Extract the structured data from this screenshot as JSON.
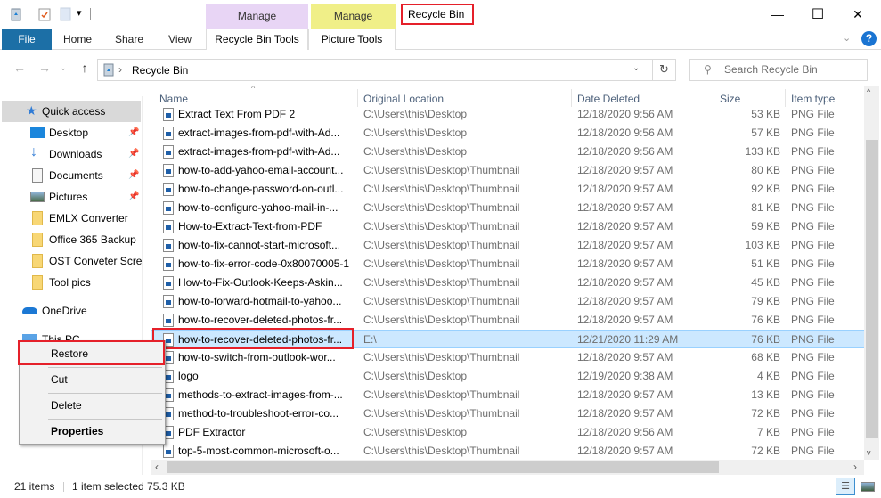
{
  "window": {
    "title": "Recycle Bin",
    "controls": {
      "minimize": "—",
      "maximize": "☐",
      "close": "✕"
    }
  },
  "ribbon": {
    "contextual_groups": [
      {
        "label": "Manage",
        "sub": "Recycle Bin Tools",
        "color": "#e8d5f5"
      },
      {
        "label": "Manage",
        "sub": "Picture Tools",
        "color": "#f0ef88"
      }
    ],
    "tabs": [
      "File",
      "Home",
      "Share",
      "View"
    ]
  },
  "address": {
    "path": "Recycle Bin",
    "separator": "›",
    "search_placeholder": "Search Recycle Bin"
  },
  "sidebar": {
    "items": [
      {
        "label": "Quick access",
        "icon": "star-icon",
        "pinned": false,
        "selected": true
      },
      {
        "label": "Desktop",
        "icon": "desktop-icon",
        "pinned": true
      },
      {
        "label": "Downloads",
        "icon": "download-icon",
        "pinned": true
      },
      {
        "label": "Documents",
        "icon": "documents-icon",
        "pinned": true
      },
      {
        "label": "Pictures",
        "icon": "pictures-icon",
        "pinned": true
      },
      {
        "label": "EMLX Converter",
        "icon": "folder-icon",
        "pinned": false
      },
      {
        "label": "Office 365 Backup",
        "icon": "folder-icon",
        "pinned": false
      },
      {
        "label": "OST Conveter  Screens",
        "icon": "folder-icon",
        "pinned": false
      },
      {
        "label": "Tool pics",
        "icon": "folder-icon",
        "pinned": false
      },
      {
        "label": "OneDrive",
        "icon": "cloud-icon",
        "pinned": false
      },
      {
        "label": "This PC",
        "icon": "pc-icon",
        "pinned": false
      }
    ]
  },
  "table": {
    "columns": [
      "Name",
      "Original Location",
      "Date Deleted",
      "Size",
      "Item type"
    ],
    "rows": [
      {
        "name": "Extract Text From PDF 2",
        "location": "C:\\Users\\this\\Desktop",
        "date": "12/18/2020 9:56 AM",
        "size": "53 KB",
        "type": "PNG File"
      },
      {
        "name": "extract-images-from-pdf-with-Ad...",
        "location": "C:\\Users\\this\\Desktop",
        "date": "12/18/2020 9:56 AM",
        "size": "57 KB",
        "type": "PNG File"
      },
      {
        "name": "extract-images-from-pdf-with-Ad...",
        "location": "C:\\Users\\this\\Desktop",
        "date": "12/18/2020 9:56 AM",
        "size": "133 KB",
        "type": "PNG File"
      },
      {
        "name": "how-to-add-yahoo-email-account...",
        "location": "C:\\Users\\this\\Desktop\\Thumbnail",
        "date": "12/18/2020 9:57 AM",
        "size": "80 KB",
        "type": "PNG File"
      },
      {
        "name": "how-to-change-password-on-outl...",
        "location": "C:\\Users\\this\\Desktop\\Thumbnail",
        "date": "12/18/2020 9:57 AM",
        "size": "92 KB",
        "type": "PNG File"
      },
      {
        "name": "how-to-configure-yahoo-mail-in-...",
        "location": "C:\\Users\\this\\Desktop\\Thumbnail",
        "date": "12/18/2020 9:57 AM",
        "size": "81 KB",
        "type": "PNG File"
      },
      {
        "name": "How-to-Extract-Text-from-PDF",
        "location": "C:\\Users\\this\\Desktop\\Thumbnail",
        "date": "12/18/2020 9:57 AM",
        "size": "59 KB",
        "type": "PNG File"
      },
      {
        "name": "how-to-fix-cannot-start-microsoft...",
        "location": "C:\\Users\\this\\Desktop\\Thumbnail",
        "date": "12/18/2020 9:57 AM",
        "size": "103 KB",
        "type": "PNG File"
      },
      {
        "name": "how-to-fix-error-code-0x80070005-1",
        "location": "C:\\Users\\this\\Desktop\\Thumbnail",
        "date": "12/18/2020 9:57 AM",
        "size": "51 KB",
        "type": "PNG File"
      },
      {
        "name": "How-to-Fix-Outlook-Keeps-Askin...",
        "location": "C:\\Users\\this\\Desktop\\Thumbnail",
        "date": "12/18/2020 9:57 AM",
        "size": "45 KB",
        "type": "PNG File"
      },
      {
        "name": "how-to-forward-hotmail-to-yahoo...",
        "location": "C:\\Users\\this\\Desktop\\Thumbnail",
        "date": "12/18/2020 9:57 AM",
        "size": "79 KB",
        "type": "PNG File"
      },
      {
        "name": "how-to-recover-deleted-photos-fr...",
        "location": "C:\\Users\\this\\Desktop\\Thumbnail",
        "date": "12/18/2020 9:57 AM",
        "size": "76 KB",
        "type": "PNG File"
      },
      {
        "name": "how-to-recover-deleted-photos-fr...",
        "location": "E:\\",
        "date": "12/21/2020 11:29 AM",
        "size": "76 KB",
        "type": "PNG File",
        "selected": true
      },
      {
        "name": "how-to-switch-from-outlook-wor...",
        "location": "C:\\Users\\this\\Desktop\\Thumbnail",
        "date": "12/18/2020 9:57 AM",
        "size": "68 KB",
        "type": "PNG File"
      },
      {
        "name": "logo",
        "location": "C:\\Users\\this\\Desktop",
        "date": "12/19/2020 9:38 AM",
        "size": "4 KB",
        "type": "PNG File"
      },
      {
        "name": "methods-to-extract-images-from-...",
        "location": "C:\\Users\\this\\Desktop\\Thumbnail",
        "date": "12/18/2020 9:57 AM",
        "size": "13 KB",
        "type": "PNG File"
      },
      {
        "name": "method-to-troubleshoot-error-co...",
        "location": "C:\\Users\\this\\Desktop\\Thumbnail",
        "date": "12/18/2020 9:57 AM",
        "size": "72 KB",
        "type": "PNG File"
      },
      {
        "name": "PDF Extractor",
        "location": "C:\\Users\\this\\Desktop",
        "date": "12/18/2020 9:56 AM",
        "size": "7 KB",
        "type": "PNG File"
      },
      {
        "name": "top-5-most-common-microsoft-o...",
        "location": "C:\\Users\\this\\Desktop\\Thumbnail",
        "date": "12/18/2020 9:57 AM",
        "size": "72 KB",
        "type": "PNG File"
      }
    ]
  },
  "context_menu": {
    "items": [
      "Restore",
      "Cut",
      "Delete",
      "Properties"
    ],
    "highlighted": "Restore"
  },
  "status": {
    "item_count": "21 items",
    "selection": "1 item selected  75.3 KB"
  },
  "colors": {
    "accent": "#1c6fa6",
    "selection": "#cce8ff",
    "highlight_box": "#e5202a"
  }
}
